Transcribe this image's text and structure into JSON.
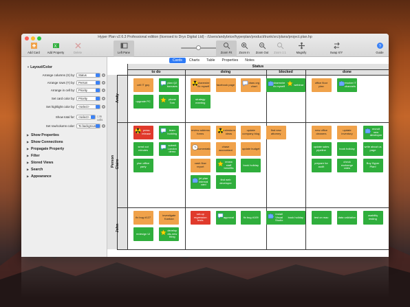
{
  "window": {
    "title": "Hyper Plan v2.6.3 Professional edition (licensed to Dryx Digital Ltd) - /Users/andybrice/hyperplan/product/trunk/src/plans/project.plan.hp"
  },
  "toolbar": {
    "buttons": [
      {
        "label": "Add Card",
        "icon": "add-card-icon"
      },
      {
        "label": "Add Property",
        "icon": "add-property-icon"
      },
      {
        "label": "Delete",
        "icon": "delete-icon"
      },
      {
        "label": "Left Pane",
        "icon": "left-pane-icon"
      },
      {
        "label": "Zoom Fit",
        "icon": "zoom-fit-icon"
      },
      {
        "label": "Zoom In",
        "icon": "zoom-in-icon"
      },
      {
        "label": "Zoom Out",
        "icon": "zoom-out-icon"
      },
      {
        "label": "Zoom 1:1",
        "icon": "zoom-actual-icon"
      },
      {
        "label": "Magnify",
        "icon": "magnify-icon"
      },
      {
        "label": "Swap X/Y",
        "icon": "swap-icon"
      },
      {
        "label": "Guide",
        "icon": "guide-icon"
      }
    ],
    "slider_label": "Zoom"
  },
  "tabs": [
    {
      "label": "Cards",
      "active": true
    },
    {
      "label": "Charts",
      "active": false
    },
    {
      "label": "Table",
      "active": false
    },
    {
      "label": "Properties",
      "active": false
    },
    {
      "label": "Notes",
      "active": false
    }
  ],
  "sidebar": {
    "section_title": "Layout/Color",
    "settings": [
      {
        "label": "Arrange columns (X) by:",
        "value": "Status"
      },
      {
        "label": "Arrange rows (Y) by:",
        "value": "Person"
      },
      {
        "label": "Arrange in cell by:",
        "value": "Priority"
      },
      {
        "label": "Set card color by:",
        "value": "Priority"
      },
      {
        "label": "Set highlight color by:",
        "value": "<select>"
      },
      {
        "label": "Show total for:",
        "value": "<select>",
        "extra": "In cells"
      },
      {
        "label": "Set row/column color:",
        "value": "To background"
      }
    ],
    "sections": [
      "Show Properties",
      "Show Connections",
      "Propagate Property",
      "Filter",
      "Stored Views",
      "Search",
      "Appearance"
    ]
  },
  "board": {
    "column_group": "Status",
    "row_group": "Person",
    "columns": [
      "to do",
      "doing",
      "blocked",
      "done"
    ],
    "rows": [
      {
        "name": "Andy",
        "todo": [
          {
            "text": "cell IT guy",
            "color": "orange"
          },
          {
            "text": "plan Q2 bonuses",
            "color": "green",
            "icon": "chat-icon"
          },
          {
            "text": "upgrade PC",
            "color": "green"
          },
          {
            "text": "phone Tom",
            "color": "green",
            "icon": "star-icon"
          }
        ],
        "doing": [
          {
            "text": "sharewire fix myself",
            "color": "orange",
            "icon": "hazard-icon"
          },
          {
            "text": "facebook page",
            "color": "orange"
          },
          {
            "text": "draw org chart",
            "color": "orange",
            "icon": "chat-icon"
          },
          {
            "text": "strategy meeting",
            "color": "green"
          }
        ],
        "blocked": [
          {
            "text": "sharewire fix myself",
            "color": "green",
            "icon": "puzzle-icon"
          },
          {
            "text": "webinar",
            "color": "green",
            "icon": "star-icon"
          }
        ],
        "done": [
          {
            "text": "office floor plan",
            "color": "orange"
          },
          {
            "text": "resolve IT channels",
            "color": "green",
            "icon": "puzzle-icon"
          }
        ]
      },
      {
        "name": "Claire",
        "todo": [
          {
            "text": "press release",
            "color": "red",
            "icon": "hazard-icon"
          },
          {
            "text": "team building",
            "color": "green",
            "icon": "chat-icon"
          },
          {
            "text": "send out minutes",
            "color": "green"
          },
          {
            "text": "submit London demo",
            "color": "green",
            "icon": "chat-icon"
          },
          {
            "text": "plan office party",
            "color": "green"
          }
        ],
        "doing": [
          {
            "text": "review address forms",
            "color": "orange"
          },
          {
            "text": "brainstorm ideas",
            "color": "orange",
            "icon": "hazard-icon"
          },
          {
            "text": "update company blog",
            "color": "orange"
          },
          {
            "text": "documentation",
            "color": "orange",
            "icon": "clock-icon"
          },
          {
            "text": "chase accountant",
            "color": "orange"
          },
          {
            "text": "update budget",
            "color": "orange"
          },
          {
            "text": "cash flow report",
            "color": "orange"
          },
          {
            "text": "renew staff benefits",
            "color": "green",
            "icon": "star-icon"
          },
          {
            "text": "book holiday",
            "color": "green"
          },
          {
            "text": "jet plan internal card",
            "color": "green",
            "icon": "puzzle-icon"
          },
          {
            "text": "find web developer",
            "color": "green"
          }
        ],
        "blocked": [
          {
            "text": "find new attorney",
            "color": "orange"
          }
        ],
        "done": [
          {
            "text": "new office cleaners",
            "color": "orange"
          },
          {
            "text": "update inventory",
            "color": "orange"
          },
          {
            "text": "recruit new developer",
            "color": "green",
            "icon": "puzzle-icon"
          },
          {
            "text": "update sales pipeline",
            "color": "green"
          },
          {
            "text": "book holiday",
            "color": "green"
          },
          {
            "text": "write about us page",
            "color": "green"
          },
          {
            "text": "prepare for audit",
            "color": "green"
          },
          {
            "text": "check exchange rates",
            "color": "green"
          },
          {
            "text": "Buy Hyper Plan!",
            "color": "green"
          }
        ]
      },
      {
        "name": "John",
        "todo": [
          {
            "text": "fix bug #127",
            "color": "orange"
          },
          {
            "text": "investigate Kanban",
            "color": "orange"
          },
          {
            "text": "redesign UI",
            "color": "green"
          },
          {
            "text": "develop dis-new thing",
            "color": "green",
            "icon": "star-icon"
          }
        ],
        "doing": [
          {
            "text": "set-up regression tests",
            "color": "red"
          },
          {
            "text": "approval",
            "color": "green",
            "icon": "chat-icon"
          },
          {
            "text": "fix bug #109",
            "color": "green"
          }
        ],
        "blocked": [
          {
            "text": "install Visual Studio",
            "color": "green",
            "icon": "puzzle-icon"
          },
          {
            "text": "book holiday",
            "color": "green"
          }
        ],
        "done": [
          {
            "text": "test on mac",
            "color": "green"
          },
          {
            "text": "data validation",
            "color": "green"
          },
          {
            "text": "usability testing",
            "color": "green"
          }
        ]
      }
    ]
  },
  "colors": {
    "orange": "#f0a24a",
    "green": "#2fae3c",
    "red": "#e03a2c",
    "tab_active": "#2f7bf6"
  }
}
